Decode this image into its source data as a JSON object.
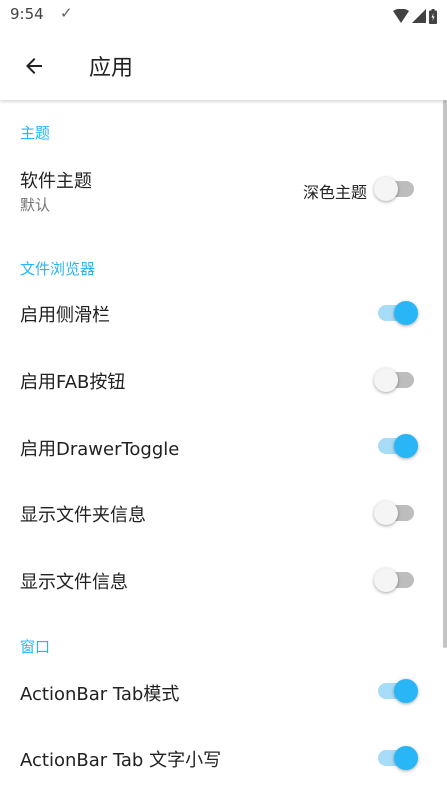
{
  "status_bar": {
    "time": "9:54",
    "check_glyph": "✓",
    "icons": [
      "wifi-icon",
      "signal-icon",
      "battery-icon"
    ]
  },
  "app_bar": {
    "title": "应用",
    "back_icon": "arrow-left-icon"
  },
  "accent_color": "#29b6f6",
  "sections": {
    "theme": {
      "header": "主题",
      "software_theme": {
        "title": "软件主题",
        "summary": "默认",
        "dark_label": "深色主题",
        "dark_on": false
      }
    },
    "browser": {
      "header": "文件浏览器",
      "sidebar": {
        "title": "启用侧滑栏",
        "on": true
      },
      "fab": {
        "title": "启用FAB按钮",
        "on": false
      },
      "drawer_toggle": {
        "title": "启用DrawerToggle",
        "on": true
      },
      "folder_info": {
        "title": "显示文件夹信息",
        "on": false
      },
      "file_info": {
        "title": "显示文件信息",
        "on": false
      }
    },
    "window": {
      "header": "窗口",
      "tab_mode": {
        "title": "ActionBar Tab模式",
        "on": true
      },
      "tab_lowercase": {
        "title": "ActionBar Tab 文字小写",
        "on": true
      }
    }
  }
}
